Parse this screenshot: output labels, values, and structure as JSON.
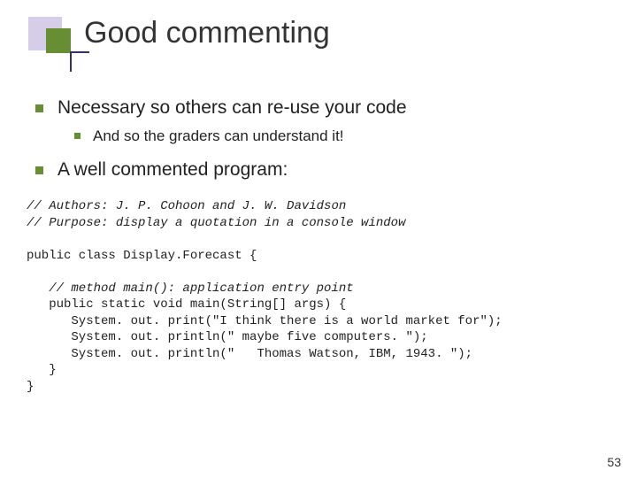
{
  "title": "Good commenting",
  "bullets": {
    "b1": "Necessary so others can re-use your code",
    "b1_1": "And so the graders can understand it!",
    "b2": "A well commented program:"
  },
  "code": {
    "c1": "// Authors: J. P. Cohoon and J. W. Davidson",
    "c2": "// Purpose: display a quotation in a console window",
    "c3": "",
    "c4": "public class Display.Forecast {",
    "c5": "",
    "c6": "   // method main(): application entry point",
    "c7": "   public static void main(String[] args) {",
    "c8": "      System. out. print(\"I think there is a world market for\");",
    "c9": "      System. out. println(\" maybe five computers. \");",
    "c10": "      System. out. println(\"   Thomas Watson, IBM, 1943. \");",
    "c11": "   }",
    "c12": "}"
  },
  "slide_number": "53"
}
